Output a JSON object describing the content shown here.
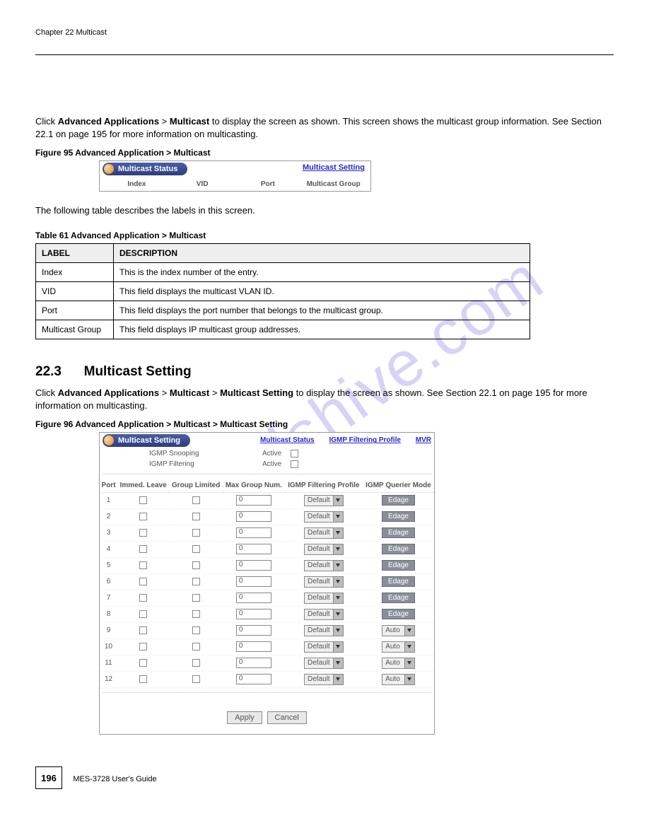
{
  "header_left": "Chapter 22 Multicast",
  "intro_para": {
    "prefix": "Click ",
    "bold1": "Advanced Applications",
    "mid": " > ",
    "bold2": "Multicast",
    "suffix": " to display the screen as shown. This screen shows the multicast group information. See Section 22.1 on page 195 for more information on multicasting."
  },
  "fig95_caption": "Figure 95   Advanced Application > Multicast",
  "fig95": {
    "pill": "Multicast Status",
    "link": "Multicast Setting",
    "cols": [
      "Index",
      "VID",
      "Port",
      "Multicast Group"
    ]
  },
  "tbl_intro": "The following table describes the labels in this screen.",
  "tbl_caption": "Table 61   Advanced Application > Multicast",
  "tbl_head": [
    "LABEL",
    "DESCRIPTION"
  ],
  "tbl_rows": [
    {
      "label": "Index",
      "desc": "This is the index number of the entry."
    },
    {
      "label": "VID",
      "desc": "This field displays the multicast VLAN ID."
    },
    {
      "label": "Port",
      "desc": "This field displays the port number that belongs to the multicast group."
    },
    {
      "label": "Multicast Group",
      "desc": "This field displays IP multicast group addresses."
    }
  ],
  "sec_num": "22.3",
  "sec_title": "Multicast Setting",
  "sec_para": {
    "prefix": "Click ",
    "b1": "Advanced Applications",
    "m1": " > ",
    "b2": "Multicast",
    "m2": " > ",
    "b3": "Multicast Setting",
    "suffix": " to display the screen as shown. See Section 22.1 on page 195 for more information on multicasting."
  },
  "fig96_caption": "Figure 96   Advanced Application > Multicast > Multicast Setting",
  "fig96": {
    "pill": "Multicast Setting",
    "links": [
      "Multicast Status",
      "IGMP Filtering Profile",
      "MVR"
    ],
    "snooping_label": "IGMP Snooping",
    "filtering_label": "IGMP Filtering",
    "active_label": "Active",
    "cols": [
      "Port",
      "Immed. Leave",
      "Group Limited",
      "Max Group Num.",
      "IGMP Filtering Profile",
      "IGMP Querier Mode"
    ],
    "default_option": "Default",
    "edge_label": "Edage",
    "auto_label": "Auto",
    "max_val": "0",
    "rows": [
      {
        "port": "1",
        "mode": "edge"
      },
      {
        "port": "2",
        "mode": "edge"
      },
      {
        "port": "3",
        "mode": "edge"
      },
      {
        "port": "4",
        "mode": "edge"
      },
      {
        "port": "5",
        "mode": "edge"
      },
      {
        "port": "6",
        "mode": "edge"
      },
      {
        "port": "7",
        "mode": "edge"
      },
      {
        "port": "8",
        "mode": "edge"
      },
      {
        "port": "9",
        "mode": "auto"
      },
      {
        "port": "10",
        "mode": "auto"
      },
      {
        "port": "11",
        "mode": "auto"
      },
      {
        "port": "12",
        "mode": "auto"
      }
    ],
    "apply": "Apply",
    "cancel": "Cancel"
  },
  "footer": {
    "page": "196",
    "text": "MES-3728 User's Guide"
  },
  "watermark": "manualshive.com"
}
